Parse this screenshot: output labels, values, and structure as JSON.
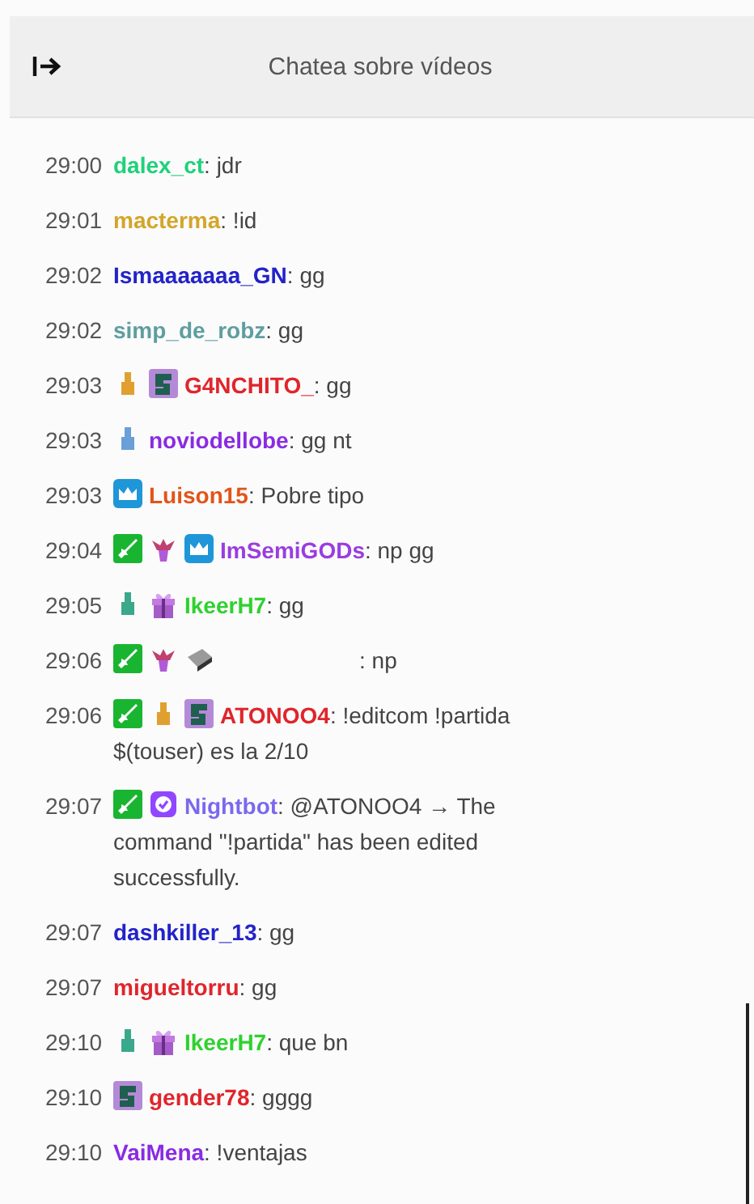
{
  "header": {
    "title": "Chatea sobre vídeos"
  },
  "messages": [
    {
      "time": "29:00",
      "user": "dalex_ct",
      "color": "#1fd17a",
      "text": ": jdr"
    },
    {
      "time": "29:01",
      "user": "macterma",
      "color": "#d4a52a",
      "text": ": !id"
    },
    {
      "time": "29:02",
      "user": "Ismaaaaaaa_GN",
      "color": "#2323c9",
      "text": ": gg"
    },
    {
      "time": "29:02",
      "user": "simp_de_robz",
      "color": "#5f9ea0",
      "text": ": gg"
    },
    {
      "time": "29:03",
      "badges": [
        {
          "kind": "figure-gold"
        },
        {
          "kind": "sub"
        }
      ],
      "user": "G4NCHITO_",
      "color": "#e0252b",
      "text": ": gg"
    },
    {
      "time": "29:03",
      "badges": [
        {
          "kind": "figure-blue"
        }
      ],
      "user": "noviodellobe",
      "color": "#8a2be2",
      "text": ": gg nt"
    },
    {
      "time": "29:03",
      "badges": [
        {
          "kind": "crown"
        }
      ],
      "user": "Luison15",
      "color": "#e25418",
      "text": ": Pobre tipo"
    },
    {
      "time": "29:04",
      "badges": [
        {
          "kind": "sword"
        },
        {
          "kind": "flower"
        },
        {
          "kind": "crown"
        }
      ],
      "user": "ImSemiGODs",
      "color": "#9a3de0",
      "text": ": np gg"
    },
    {
      "time": "29:05",
      "badges": [
        {
          "kind": "figure-teal"
        },
        {
          "kind": "gift"
        }
      ],
      "user": "IkeerH7",
      "color": "#2fd12f",
      "text": ": gg"
    },
    {
      "time": "29:06",
      "badges": [
        {
          "kind": "sword"
        },
        {
          "kind": "flower"
        },
        {
          "kind": "keyboard"
        }
      ],
      "text": ": np"
    },
    {
      "time": "29:06",
      "badges": [
        {
          "kind": "sword"
        },
        {
          "kind": "figure-gold"
        },
        {
          "kind": "sub"
        }
      ],
      "user": "ATONOO4",
      "color": "#e0252b",
      "text": ": !editcom !partida",
      "more": [
        "$(touser) es la 2/10"
      ]
    },
    {
      "time": "29:07",
      "badges": [
        {
          "kind": "sword"
        },
        {
          "kind": "bot"
        }
      ],
      "user": "Nightbot",
      "color": "#7b68ee",
      "text": ": @ATONOO4 → The",
      "more": [
        "command \"!partida\" has been edited",
        "successfully."
      ]
    },
    {
      "time": "29:07",
      "user": "dashkiller_13",
      "color": "#2323c9",
      "text": ": gg"
    },
    {
      "time": "29:07",
      "user": "migueltorru",
      "color": "#e0252b",
      "text": ": gg"
    },
    {
      "time": "29:10",
      "badges": [
        {
          "kind": "figure-teal"
        },
        {
          "kind": "gift"
        }
      ],
      "user": "IkeerH7",
      "color": "#2fd12f",
      "text": ": que bn"
    },
    {
      "time": "29:10",
      "badges": [
        {
          "kind": "sub"
        }
      ],
      "user": "gender78",
      "color": "#e0252b",
      "text": ": gggg"
    },
    {
      "time": "29:10",
      "user": "VaiMena",
      "color": "#8a2be2",
      "text": ": !ventajas"
    }
  ]
}
